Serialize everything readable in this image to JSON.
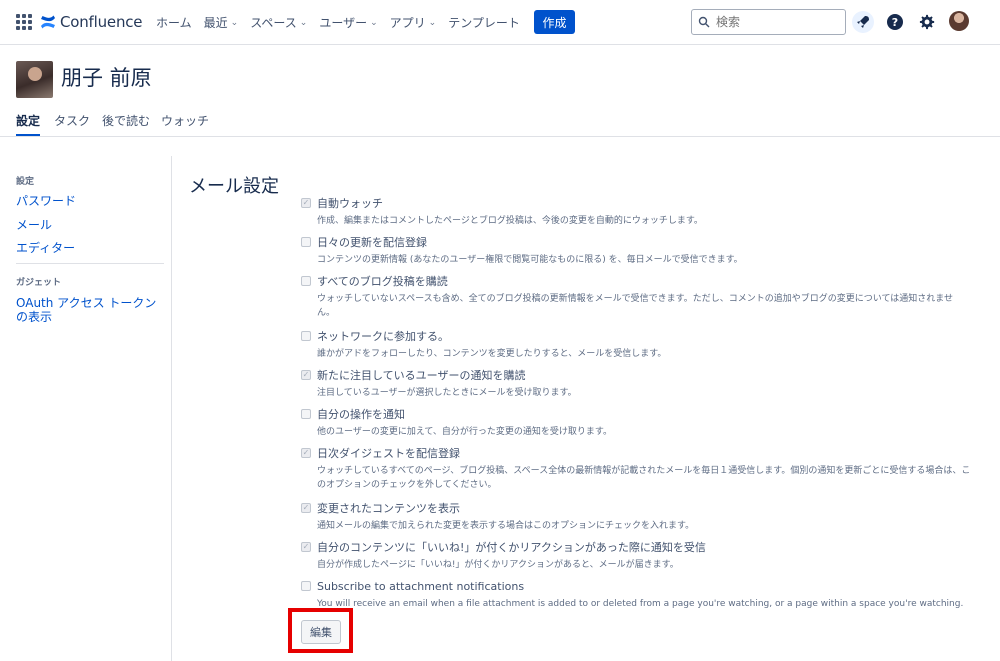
{
  "nav": {
    "logo": "Confluence",
    "items": [
      {
        "label": "ホーム",
        "dropdown": false
      },
      {
        "label": "最近",
        "dropdown": true
      },
      {
        "label": "スペース",
        "dropdown": true
      },
      {
        "label": "ユーザー",
        "dropdown": true
      },
      {
        "label": "アプリ",
        "dropdown": true
      },
      {
        "label": "テンプレート",
        "dropdown": false
      }
    ],
    "create_label": "作成",
    "search_placeholder": "検索",
    "accent": "#0052cc"
  },
  "profile": {
    "name": "朋子 前原"
  },
  "tabs": [
    {
      "label": "設定",
      "active": true
    },
    {
      "label": "タスク",
      "active": false
    },
    {
      "label": "後で読む",
      "active": false
    },
    {
      "label": "ウォッチ",
      "active": false
    }
  ],
  "sidebar": {
    "heading1": "設定",
    "links1": [
      "パスワード",
      "メール",
      "エディター"
    ],
    "heading2": "ガジェット",
    "links2": [
      "OAuth アクセス トークンの表示"
    ]
  },
  "main": {
    "title": "メール設定",
    "settings": [
      {
        "label": "自動ウォッチ",
        "checked": true,
        "desc": "作成、編集またはコメントしたページとブログ投稿は、今後の変更を自動的にウォッチします。"
      },
      {
        "label": "日々の更新を配信登録",
        "checked": false,
        "desc": "コンテンツの更新情報 (あなたのユーザー権限で閲覧可能なものに限る) を、毎日メールで受信できます。"
      },
      {
        "label": "すべてのブログ投稿を購読",
        "checked": false,
        "desc": "ウォッチしていないスペースも含め、全てのブログ投稿の更新情報をメールで受信できます。ただし、コメントの追加やブログの変更については通知されません。"
      },
      {
        "label": "ネットワークに参加する。",
        "checked": false,
        "desc": "誰かがアドをフォローしたり、コンテンツを変更したりすると、メールを受信します。"
      },
      {
        "label": "新たに注目しているユーザーの通知を購読",
        "checked": true,
        "desc": "注目しているユーザーが選択したときにメールを受け取ります。"
      },
      {
        "label": "自分の操作を通知",
        "checked": false,
        "desc": "他のユーザーの変更に加えて、自分が行った変更の通知を受け取ります。"
      },
      {
        "label": "日次ダイジェストを配信登録",
        "checked": true,
        "desc": "ウォッチしているすべてのページ、ブログ投稿、スペース全体の最新情報が記載されたメールを毎日１通受信します。個別の通知を更新ごとに受信する場合は、このオプションのチェックを外してください。"
      },
      {
        "label": "変更されたコンテンツを表示",
        "checked": true,
        "desc": "通知メールの編集で加えられた変更を表示する場合はこのオプションにチェックを入れます。"
      },
      {
        "label": "自分のコンテンツに「いいね!」が付くかリアクションがあった際に通知を受信",
        "checked": true,
        "desc": "自分が作成したページに「いいね!」が付くかリアクションがあると、メールが届きます。"
      },
      {
        "label": "Subscribe to attachment notifications",
        "checked": false,
        "desc": "You will receive an email when a file attachment is added to or deleted from a page you're watching, or a page within a space you're watching."
      }
    ],
    "edit_label": "編集"
  }
}
